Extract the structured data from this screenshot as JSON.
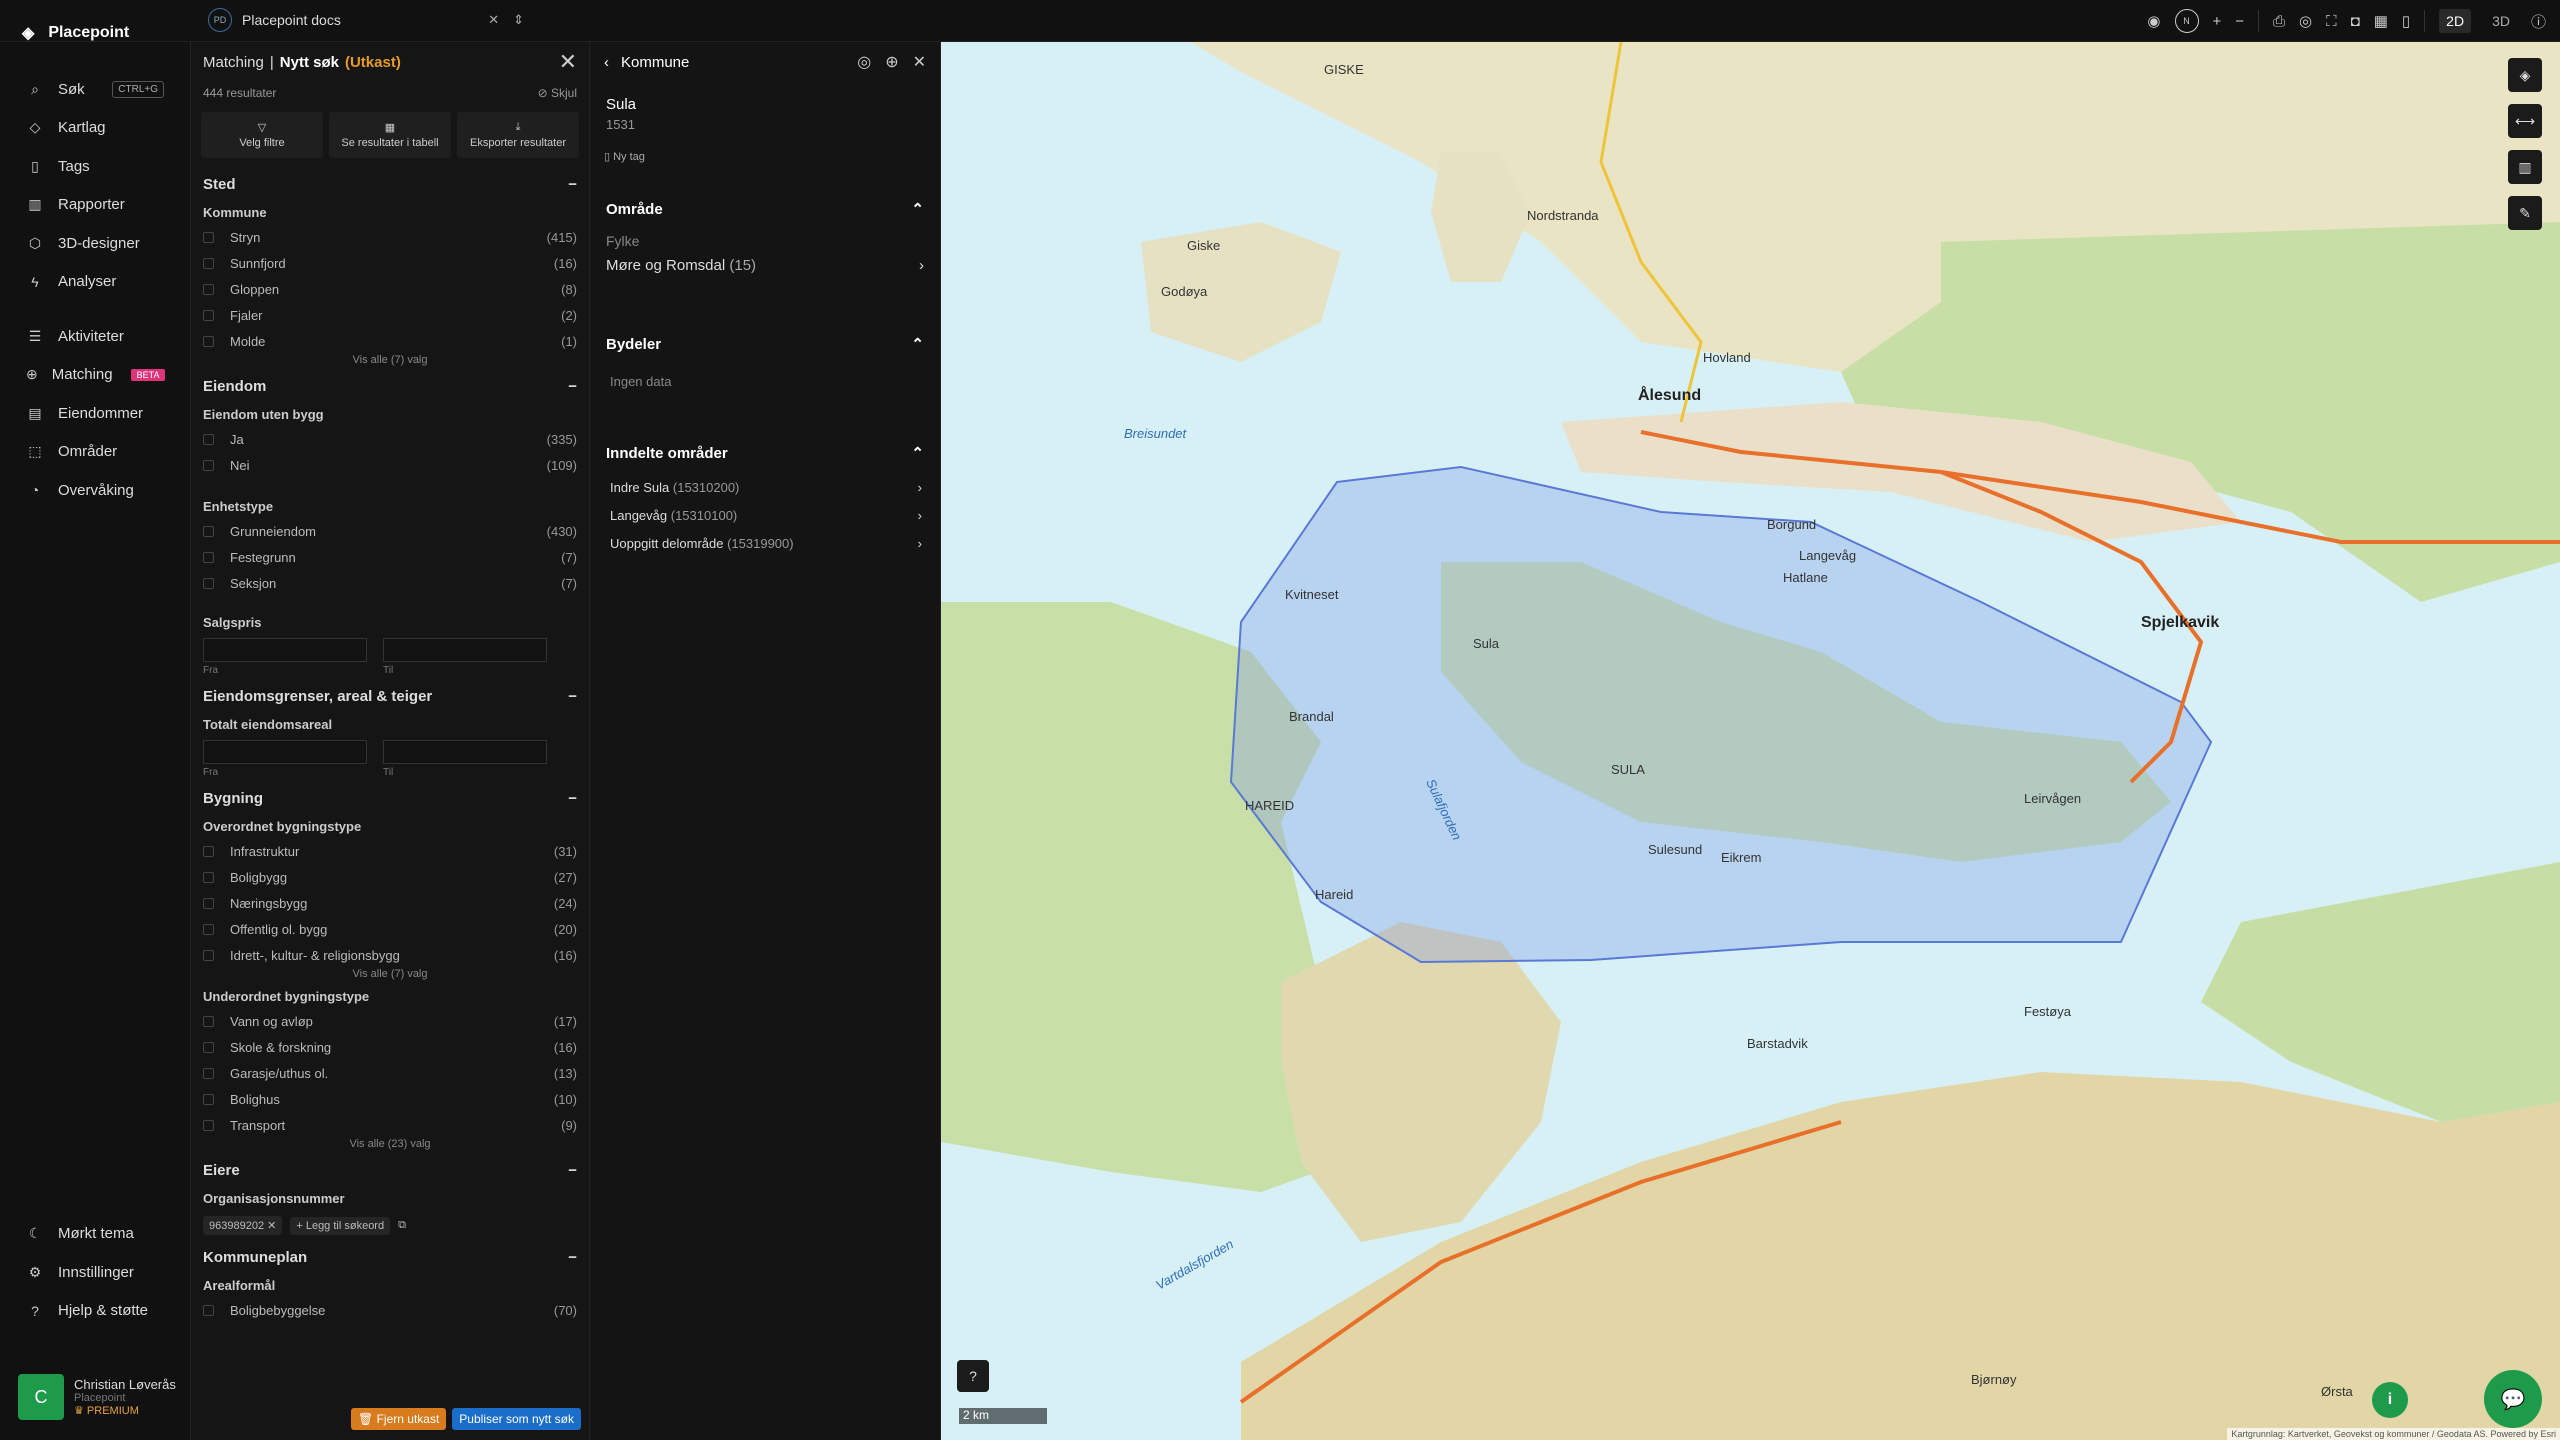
{
  "app": {
    "name": "Placepoint"
  },
  "doc": {
    "badge": "PD",
    "name": "Placepoint docs"
  },
  "toolbar": {
    "compass": "N",
    "dim2d": "2D",
    "dim3d": "3D"
  },
  "nav": {
    "top": [
      {
        "label": "Søk",
        "icon": "search-icon",
        "kbd": "CTRL+G"
      },
      {
        "label": "Kartlag",
        "icon": "layers-icon"
      },
      {
        "label": "Tags",
        "icon": "bookmark-icon"
      },
      {
        "label": "Rapporter",
        "icon": "chart-icon"
      },
      {
        "label": "3D-designer",
        "icon": "cube-icon"
      },
      {
        "label": "Analyser",
        "icon": "bolt-icon"
      }
    ],
    "mid": [
      {
        "label": "Aktiviteter",
        "icon": "activity-icon"
      },
      {
        "label": "Matching",
        "icon": "match-icon",
        "badge": "BETA"
      },
      {
        "label": "Eiendommer",
        "icon": "building-icon"
      },
      {
        "label": "Områder",
        "icon": "area-icon"
      },
      {
        "label": "Overvåking",
        "icon": "monitor-icon"
      }
    ],
    "bottom": [
      {
        "label": "Mørkt tema",
        "icon": "moon-icon"
      },
      {
        "label": "Innstillinger",
        "icon": "gear-icon"
      },
      {
        "label": "Hjelp & støtte",
        "icon": "help-icon"
      }
    ]
  },
  "user": {
    "initial": "C",
    "name": "Christian Løverås",
    "org": "Placepoint",
    "plan": "PREMIUM"
  },
  "filter": {
    "crumb": "Matching",
    "sep": "|",
    "title": "Nytt søk",
    "status": "(Utkast)",
    "results": "444 resultater",
    "hide": "Skjul",
    "btn_filter": "Velg filtre",
    "btn_table": "Se resultater i tabell",
    "btn_export": "Eksporter resultater",
    "sted": "Sted",
    "kommune": "Kommune",
    "kommuner": [
      {
        "l": "Stryn",
        "n": "(415)"
      },
      {
        "l": "Sunnfjord",
        "n": "(16)"
      },
      {
        "l": "Gloppen",
        "n": "(8)"
      },
      {
        "l": "Fjaler",
        "n": "(2)"
      },
      {
        "l": "Molde",
        "n": "(1)"
      }
    ],
    "more1": "Vis alle (7) valg",
    "eiendom": "Eiendom",
    "uten_bygg": "Eiendom uten bygg",
    "uten": [
      {
        "l": "Ja",
        "n": "(335)"
      },
      {
        "l": "Nei",
        "n": "(109)"
      }
    ],
    "enhetstype": "Enhetstype",
    "enheter": [
      {
        "l": "Grunneiendom",
        "n": "(430)"
      },
      {
        "l": "Festegrunn",
        "n": "(7)"
      },
      {
        "l": "Seksjon",
        "n": "(7)"
      }
    ],
    "salgspris": "Salgspris",
    "fra": "Fra",
    "til": "Til",
    "grenser": "Eiendomsgrenser, areal & teiger",
    "totalt": "Totalt eiendomsareal",
    "bygning": "Bygning",
    "overordnet": "Overordnet bygningstype",
    "over": [
      {
        "l": "Infrastruktur",
        "n": "(31)"
      },
      {
        "l": "Boligbygg",
        "n": "(27)"
      },
      {
        "l": "Næringsbygg",
        "n": "(24)"
      },
      {
        "l": "Offentlig ol. bygg",
        "n": "(20)"
      },
      {
        "l": "Idrett-, kultur- & religionsbygg",
        "n": "(16)"
      }
    ],
    "more2": "Vis alle (7) valg",
    "underordnet": "Underordnet bygningstype",
    "under": [
      {
        "l": "Vann og avløp",
        "n": "(17)"
      },
      {
        "l": "Skole & forskning",
        "n": "(16)"
      },
      {
        "l": "Garasje/uthus ol.",
        "n": "(13)"
      },
      {
        "l": "Bolighus",
        "n": "(10)"
      },
      {
        "l": "Transport",
        "n": "(9)"
      }
    ],
    "more3": "Vis alle (23) valg",
    "eiere": "Eiere",
    "orgnr": "Organisasjonsnummer",
    "orgval": "963989202",
    "legg": "Legg til søkeord",
    "kommuneplan": "Kommuneplan",
    "arealformal": "Arealformål",
    "bolig": "Boligbebyggelse",
    "bolign": "(70)",
    "remove": "Fjern utkast",
    "publish": "Publiser som nytt søk"
  },
  "detail": {
    "header": "Kommune",
    "name": "Sula",
    "number": "1531",
    "tag": "Ny tag",
    "omrade": "Område",
    "fylke_label": "Fylke",
    "fylke": "Møre og Romsdal",
    "fylke_n": "(15)",
    "bydeler": "Bydeler",
    "ingen": "Ingen data",
    "inndelte": "Inndelte områder",
    "areas": [
      {
        "l": "Indre Sula",
        "c": "(15310200)"
      },
      {
        "l": "Langevåg",
        "c": "(15310100)"
      },
      {
        "l": "Uoppgitt delområde",
        "c": "(15319900)"
      }
    ]
  },
  "map": {
    "scale": "2 km",
    "attribution": "Kartgrunnlag: Kartverket, Geovekst og kommuner / Geodata AS. Powered by Esri",
    "labels": [
      {
        "t": "Ålesund",
        "c": "big"
      },
      {
        "t": "Spjelkavik",
        "c": "big"
      },
      {
        "t": "GISKE",
        "c": ""
      },
      {
        "t": "Langevåg",
        "c": ""
      },
      {
        "t": "Sula",
        "c": ""
      },
      {
        "t": "SULA",
        "c": ""
      },
      {
        "t": "Brandal",
        "c": ""
      },
      {
        "t": "Hareid",
        "c": ""
      },
      {
        "t": "HAREID",
        "c": ""
      },
      {
        "t": "Breisundet",
        "c": "water"
      },
      {
        "t": "Sulafjorden",
        "c": "water"
      },
      {
        "t": "Vartdalsfjorden",
        "c": "water"
      },
      {
        "t": "Giske",
        "c": ""
      },
      {
        "t": "Godøya",
        "c": ""
      },
      {
        "t": "Hovland",
        "c": ""
      },
      {
        "t": "Nordstranda",
        "c": ""
      },
      {
        "t": "Borgund",
        "c": ""
      },
      {
        "t": "Hatlane",
        "c": ""
      },
      {
        "t": "Leirvågen",
        "c": ""
      },
      {
        "t": "Sulesund",
        "c": ""
      },
      {
        "t": "Eikrem",
        "c": ""
      },
      {
        "t": "Bjørnøy",
        "c": ""
      },
      {
        "t": "Kvitneset",
        "c": ""
      },
      {
        "t": "Barstadvik",
        "c": ""
      },
      {
        "t": "Festøya",
        "c": ""
      },
      {
        "t": "Ørsta",
        "c": ""
      }
    ]
  }
}
